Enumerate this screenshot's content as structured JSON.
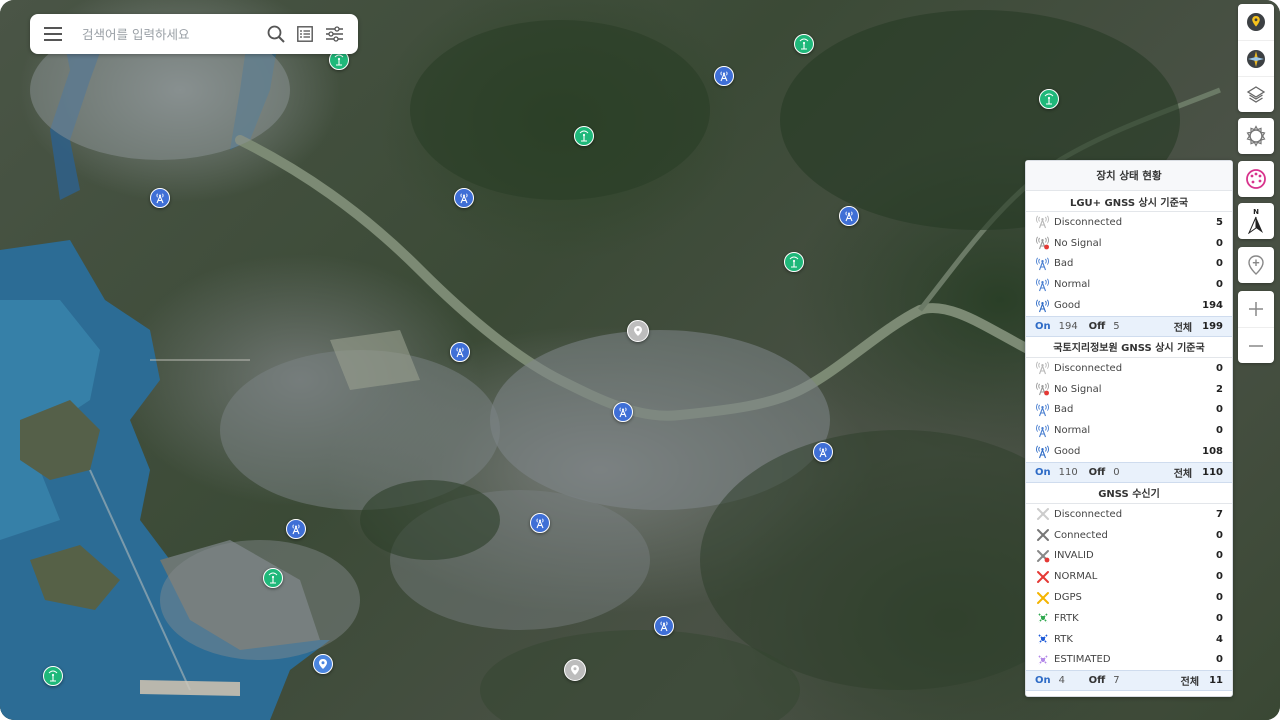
{
  "search": {
    "placeholder": "검색어를 입력하세요"
  },
  "toolbar": {
    "top_icons": [
      "location-pin-icon",
      "compass-map-icon",
      "layers-icon"
    ],
    "settings_icon": "gear-icon",
    "palette_icon": "palette-icon",
    "north_icon": "north-arrow-icon",
    "north_label": "N",
    "add_marker_icon": "add-marker-icon",
    "zoom_in_icon": "plus-icon",
    "zoom_out_icon": "minus-icon"
  },
  "status_panel": {
    "title": "장치 상태 현황",
    "sections": [
      {
        "title": "LGU+ GNSS 상시 기준국",
        "rows": [
          {
            "label": "Disconnected",
            "count": "5",
            "color": "#b8b8b8"
          },
          {
            "label": "No Signal",
            "count": "0",
            "color": "#9a9a9a"
          },
          {
            "label": "Bad",
            "count": "0",
            "color": "#4a7fd0"
          },
          {
            "label": "Normal",
            "count": "0",
            "color": "#4a7fd0"
          },
          {
            "label": "Good",
            "count": "194",
            "color": "#2e6bc6"
          }
        ],
        "on_label": "On",
        "on": "194",
        "off_label": "Off",
        "off": "5",
        "total_label": "전체",
        "total": "199"
      },
      {
        "title": "국토지리정보원 GNSS 상시 기준국",
        "rows": [
          {
            "label": "Disconnected",
            "count": "0",
            "color": "#b8b8b8"
          },
          {
            "label": "No Signal",
            "count": "2",
            "color": "#9a9a9a"
          },
          {
            "label": "Bad",
            "count": "0",
            "color": "#4a7fd0"
          },
          {
            "label": "Normal",
            "count": "0",
            "color": "#4a7fd0"
          },
          {
            "label": "Good",
            "count": "108",
            "color": "#2e6bc6"
          }
        ],
        "on_label": "On",
        "on": "110",
        "off_label": "Off",
        "off": "0",
        "total_label": "전체",
        "total": "110"
      },
      {
        "title": "GNSS 수신기",
        "rows": [
          {
            "label": "Disconnected",
            "count": "7",
            "color": "#cccccc"
          },
          {
            "label": "Connected",
            "count": "0",
            "color": "#777777"
          },
          {
            "label": "INVALID",
            "count": "0",
            "color": "#888888"
          },
          {
            "label": "NORMAL",
            "count": "0",
            "color": "#e53935"
          },
          {
            "label": "DGPS",
            "count": "0",
            "color": "#f4b400"
          },
          {
            "label": "FRTK",
            "count": "0",
            "color": "#2fa84f"
          },
          {
            "label": "RTK",
            "count": "4",
            "color": "#1e5bd8"
          },
          {
            "label": "ESTIMATED",
            "count": "0",
            "color": "#b388e8"
          }
        ],
        "on_label": "On",
        "on": "4",
        "off_label": "Off",
        "off": "7",
        "total_label": "전체",
        "total": "11"
      }
    ]
  },
  "map_markers": {
    "blue_station_icon": "broadcast-tower-icon",
    "green_station_icon": "antenna-icon",
    "gray_marker_icon": "map-pin-icon"
  }
}
